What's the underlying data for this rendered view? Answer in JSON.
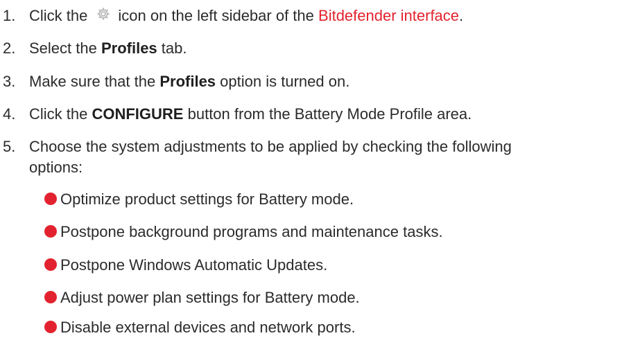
{
  "steps": [
    {
      "num": "1.",
      "before_icon": "Click the",
      "icon": "settings-gear-icon",
      "after_icon": "icon on the left sidebar of the",
      "link_text": "Bitdefender interface",
      "end": "."
    },
    {
      "num": "2.",
      "pre": "Select the",
      "bold": "Profiles",
      "post": "tab."
    },
    {
      "num": "3.",
      "pre": "Make sure that the",
      "bold": "Profiles",
      "post": "option is turned on."
    },
    {
      "num": "4.",
      "pre": "Click the",
      "bold": "CONFIGURE",
      "post": "button from the Battery Mode Profile area."
    },
    {
      "num": "5.",
      "line1": "Choose the system adjustments to be applied by checking the following",
      "line2": "options:"
    }
  ],
  "options": [
    "Optimize product settings for Battery mode.",
    "Postpone background programs and maintenance tasks.",
    "Postpone Windows Automatic Updates.",
    "Adjust power plan settings for Battery mode.",
    "Disable external devices and network ports."
  ],
  "colors": {
    "link": "#e2232f",
    "bullet": "#e2232f",
    "gear": "#b8b8b8"
  }
}
